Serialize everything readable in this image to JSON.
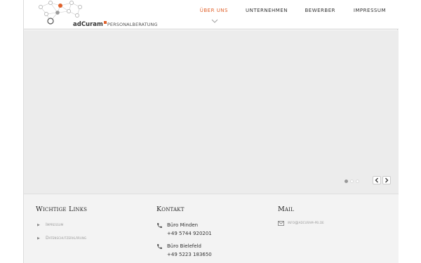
{
  "logo": {
    "brand": "adCuram",
    "sub": "PERSONALBERATUNG",
    "accent": "#e0612b"
  },
  "nav": {
    "items": [
      {
        "label": "ÜBER UNS",
        "active": true
      },
      {
        "label": "UNTERNEHMEN",
        "active": false
      },
      {
        "label": "BEWERBER",
        "active": false
      },
      {
        "label": "IMPRESSUM",
        "active": false
      }
    ]
  },
  "slider": {
    "dot_count": 3,
    "active_dot": 1,
    "prev_icon": "chevron-left-icon",
    "next_icon": "chevron-right-icon"
  },
  "footer": {
    "links": {
      "title": "Wichtige Links",
      "items": [
        "Impressum",
        "Datenschutzerklärung"
      ]
    },
    "contact": {
      "title": "Kontakt",
      "offices": [
        {
          "name": "Büro Minden",
          "phone": "+49 5744 920201",
          "icon": "phone-icon"
        },
        {
          "name": "Büro Bielefeld",
          "phone": "+49 5223 183650",
          "icon": "phone-icon"
        }
      ]
    },
    "mail": {
      "title": "Mail",
      "address": "info@adcuram-pb.de",
      "icon": "envelope-icon"
    }
  }
}
